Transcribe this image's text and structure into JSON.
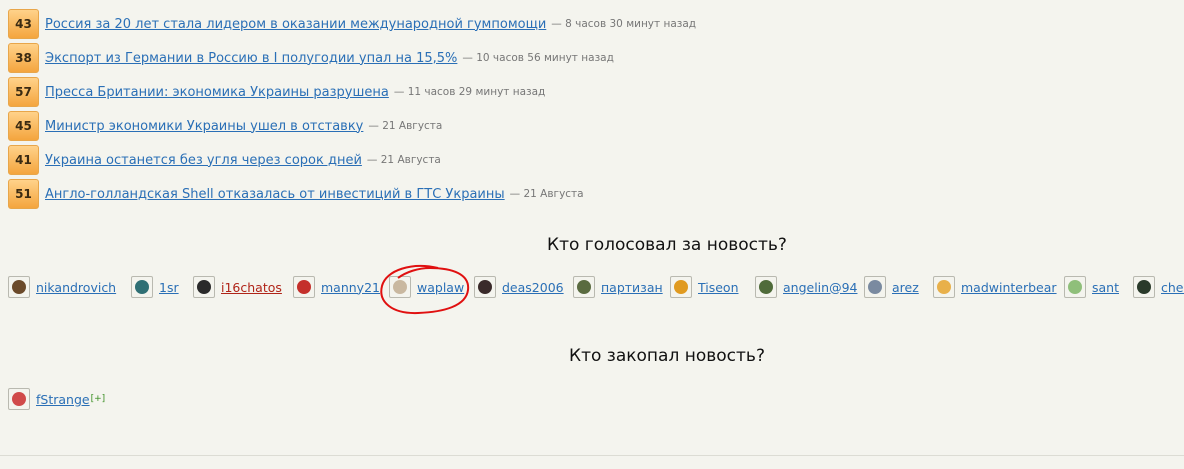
{
  "news": [
    {
      "votes": "43",
      "title": "Россия за 20 лет стала лидером в оказании международной гумпомощи",
      "time": "— 8 часов 30 минут назад"
    },
    {
      "votes": "38",
      "title": "Экспорт из Германии в Россию в I полугодии упал на 15,5%",
      "time": "— 10 часов 56 минут назад"
    },
    {
      "votes": "57",
      "title": "Пресса Британии: экономика Украины разрушена",
      "time": "— 11 часов 29 минут назад"
    },
    {
      "votes": "45",
      "title": "Министр экономики Украины ушел в отставку",
      "time": "— 21 Августа"
    },
    {
      "votes": "41",
      "title": "Украина останется без угля через сорок дней",
      "time": "— 21 Августа"
    },
    {
      "votes": "51",
      "title": "Англо-голландская Shell отказалась от инвестиций в ГТС Украины",
      "time": "— 21 Августа"
    }
  ],
  "voted_title": "Кто голосовал за новость?",
  "voters": [
    {
      "name": "nikandrovich",
      "color": "#6b4a2a"
    },
    {
      "name": "1sr",
      "color": "#2f6f74"
    },
    {
      "name": "i16chatos",
      "color": "#2a2a2a"
    },
    {
      "name": "manny21",
      "color": "#c4302b"
    },
    {
      "name": "waplaw",
      "color": "#c9b8a0"
    },
    {
      "name": "deas2006",
      "color": "#3a2a2a"
    },
    {
      "name": "партизан",
      "color": "#5a6b40"
    },
    {
      "name": "Tiseon",
      "color": "#e09a20"
    },
    {
      "name": "angelin@94",
      "color": "#4f6b3a"
    },
    {
      "name": "arez",
      "color": "#7a8aa0"
    },
    {
      "name": "madwinterbear",
      "color": "#e8b04a"
    },
    {
      "name": "sant",
      "color": "#8fbf7a"
    },
    {
      "name": "chel",
      "color": "#2a3a2a"
    }
  ],
  "buried_title": "Кто закопал новость?",
  "buriers": [
    {
      "name": "fStrange",
      "color": "#d04a4a",
      "mark": "[+]"
    }
  ]
}
